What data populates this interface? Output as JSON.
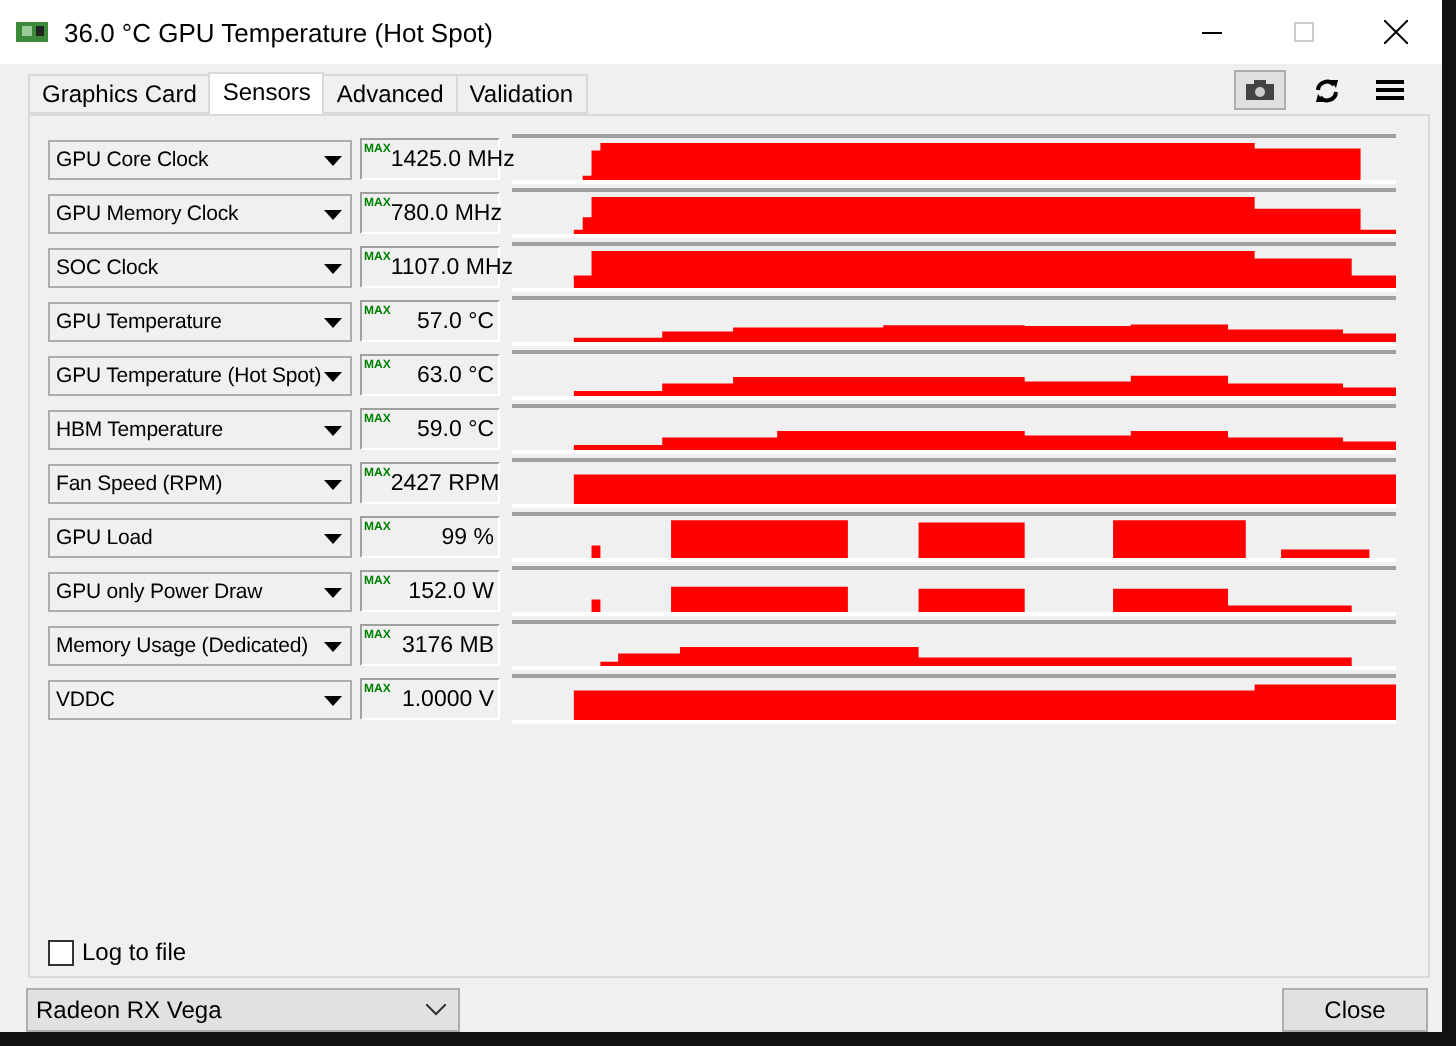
{
  "window": {
    "title": "36.0 °C GPU Temperature (Hot Spot)"
  },
  "tabs": [
    {
      "label": "Graphics Card",
      "selected": false
    },
    {
      "label": "Sensors",
      "selected": true
    },
    {
      "label": "Advanced",
      "selected": false
    },
    {
      "label": "Validation",
      "selected": false
    }
  ],
  "sensors": [
    {
      "name": "GPU Core Clock",
      "max_label": "MAX",
      "value": "1425.0 MHz"
    },
    {
      "name": "GPU Memory Clock",
      "max_label": "MAX",
      "value": "780.0 MHz"
    },
    {
      "name": "SOC Clock",
      "max_label": "MAX",
      "value": "1107.0 MHz"
    },
    {
      "name": "GPU Temperature",
      "max_label": "MAX",
      "value": "57.0 °C"
    },
    {
      "name": "GPU Temperature (Hot Spot)",
      "max_label": "MAX",
      "value": "63.0 °C"
    },
    {
      "name": "HBM Temperature",
      "max_label": "MAX",
      "value": "59.0 °C"
    },
    {
      "name": "Fan Speed (RPM)",
      "max_label": "MAX",
      "value": "2427 RPM"
    },
    {
      "name": "GPU Load",
      "max_label": "MAX",
      "value": "99 %"
    },
    {
      "name": "GPU only Power Draw",
      "max_label": "MAX",
      "value": "152.0 W"
    },
    {
      "name": "Memory Usage (Dedicated)",
      "max_label": "MAX",
      "value": "3176 MB"
    },
    {
      "name": "VDDC",
      "max_label": "MAX",
      "value": "1.0000 V"
    }
  ],
  "log_to_file": {
    "label": "Log to file",
    "checked": false
  },
  "gpu_select": {
    "value": "Radeon RX Vega"
  },
  "close_button": {
    "label": "Close"
  }
}
